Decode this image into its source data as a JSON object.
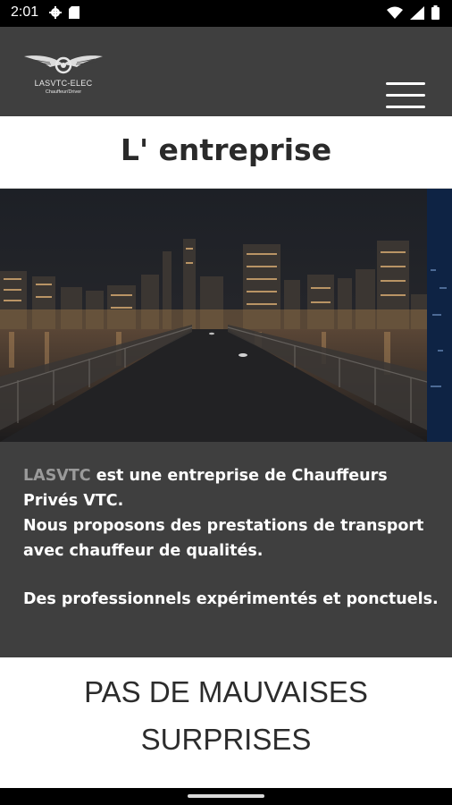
{
  "status_bar": {
    "time": "2:01",
    "icons": [
      "gear-icon",
      "sim-card-icon",
      "wifi-icon",
      "signal-icon",
      "battery-icon"
    ]
  },
  "header": {
    "logo_name": "LASVTC-ELEC",
    "logo_subtitle": "Chauffeur/Driver",
    "menu_icon": "hamburger-menu-icon"
  },
  "page": {
    "title": "L' entreprise"
  },
  "intro": {
    "brand": "LASVTC",
    "line1_rest": " est une entreprise de Chauffeurs Privés VTC.",
    "line2": "Nous proposons des prestations de transport avec chauffeur de qualités.",
    "line3": "Des professionnels expérimentés et ponctuels."
  },
  "slogan": {
    "line1": "PAS DE MAUVAISES",
    "line2": "SURPRISES"
  },
  "colors": {
    "header_bg": "#3f3f3f",
    "text_panel_bg": "#3f3f3f",
    "brand_text": "#9a9a9a"
  }
}
